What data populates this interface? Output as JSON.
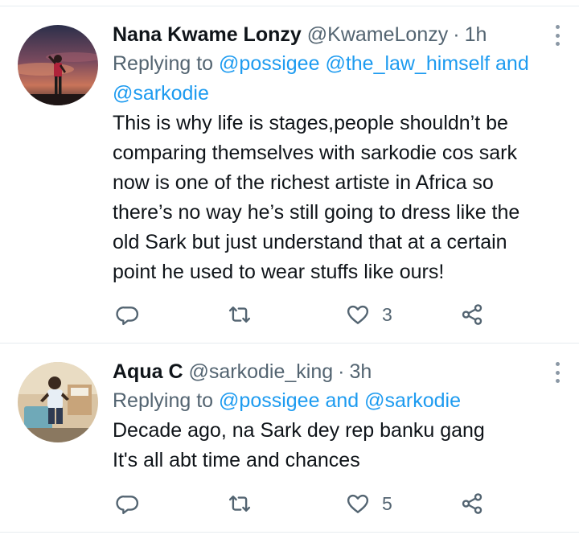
{
  "tweets": [
    {
      "display_name": "Nana Kwame Lonzy",
      "handle": "@KwameLonzy",
      "separator": "·",
      "time": "1h",
      "replying_prefix": "Replying to",
      "mention_1": "@possigee",
      "mention_2": "@the_law_himself",
      "joiner": "and",
      "mention_3": "@sarkodie",
      "body_lines": [
        "This is why life is stages,people shouldn’t be",
        "comparing themselves with sarkodie cos sark",
        "now is one of the richest artiste in Africa so",
        "there’s no way he’s still going to dress like the",
        "old Sark but just understand that at a certain",
        "point he used to wear stuffs like ours!"
      ],
      "like_count": "3"
    },
    {
      "display_name": "Aqua C",
      "handle": "@sarkodie_king",
      "separator": "·",
      "time": "3h",
      "replying_prefix": "Replying to",
      "mention_1": "@possigee",
      "joiner": "and",
      "mention_2": "@sarkodie",
      "body_lines": [
        "Decade ago, na Sark dey rep banku gang",
        "It's all abt time and chances"
      ],
      "like_count": "5"
    }
  ],
  "icons": {
    "reply": "speech-bubble-icon",
    "retweet": "retweet-arrows-icon",
    "like": "heart-outline-icon",
    "share": "share-nodes-icon",
    "more": "vertical-ellipsis-icon"
  },
  "colors": {
    "mention": "#1d9bf0",
    "secondary_text": "#536471",
    "primary_text": "#0f1419",
    "divider": "#e6ecf0"
  }
}
